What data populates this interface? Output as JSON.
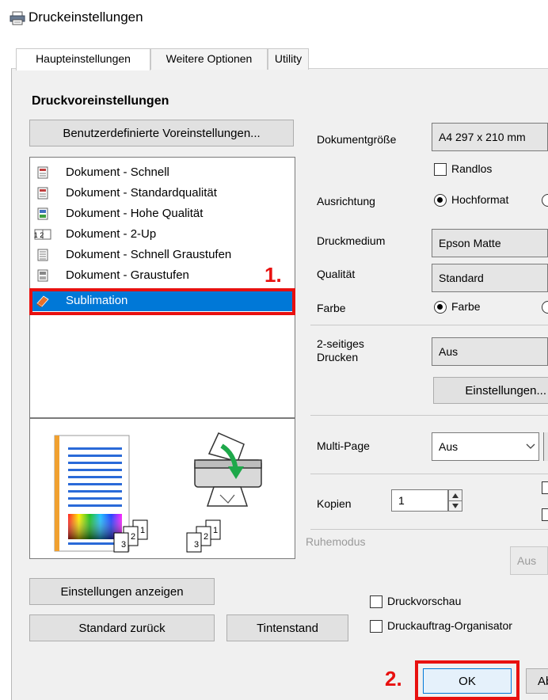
{
  "window": {
    "title": "Druckeinstellungen"
  },
  "tabs": [
    {
      "label": "Haupteinstellungen"
    },
    {
      "label": "Weitere Optionen"
    },
    {
      "label": "Utility"
    }
  ],
  "presets": {
    "title": "Druckvoreinstellungen",
    "custom_button": "Benutzerdefinierte Voreinstellungen...",
    "items": [
      {
        "label": "Dokument - Schnell"
      },
      {
        "label": "Dokument - Standardqualität"
      },
      {
        "label": "Dokument - Hohe Qualität"
      },
      {
        "label": "Dokument - 2-Up"
      },
      {
        "label": "Dokument - Schnell Graustufen"
      },
      {
        "label": "Dokument - Graustufen"
      },
      {
        "label": "Sublimation"
      }
    ],
    "selected_index": 6,
    "icon_2up_text": "1 2",
    "stack_labels": [
      "3",
      "2",
      "1"
    ]
  },
  "bottom_buttons": {
    "show_settings": "Einstellungen anzeigen",
    "reset": "Standard zurück",
    "ink_levels": "Tintenstand"
  },
  "settings": {
    "document_size_label": "Dokumentgröße",
    "document_size_value": "A4 297 x 210 mm",
    "borderless_label": "Randlos",
    "orientation_label": "Ausrichtung",
    "orientation_value": "Hochformat",
    "media_label": "Druckmedium",
    "media_value": "Epson Matte",
    "quality_label": "Qualität",
    "quality_value": "Standard",
    "color_label": "Farbe",
    "color_value": "Farbe",
    "duplex_label": "2-seitiges Drucken",
    "duplex_value": "Aus",
    "duplex_settings_button": "Einstellungen...",
    "multipage_label": "Multi-Page",
    "multipage_value": "Aus",
    "copies_label": "Kopien",
    "copies_value": "1",
    "quiet_label": "Ruhemodus",
    "quiet_value": "Aus",
    "preview_label": "Druckvorschau",
    "organizer_label": "Druckauftrag-Organisator"
  },
  "dialog_buttons": {
    "ok": "OK",
    "cancel_partial": "Ab"
  },
  "annotations": {
    "step1": "1.",
    "step2": "2."
  },
  "colors": {
    "selection": "#0078d7",
    "highlight": "#e8100f"
  }
}
